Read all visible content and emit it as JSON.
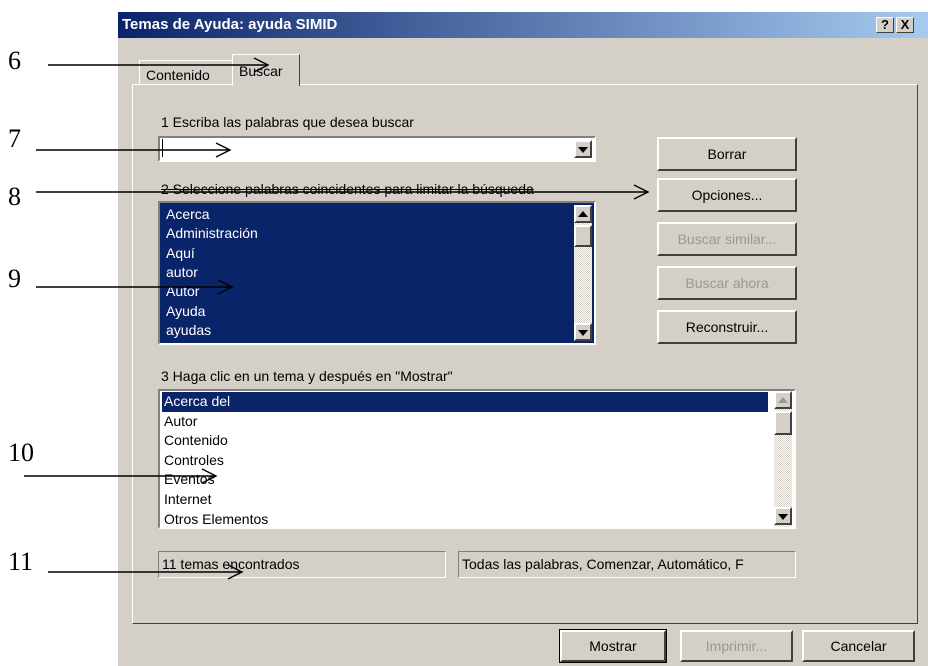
{
  "window": {
    "title": "Temas de Ayuda: ayuda SIMID",
    "help_btn": "?",
    "close_btn": "X"
  },
  "tabs": [
    {
      "label": "Contenido",
      "active": false
    },
    {
      "label": "Buscar",
      "active": true
    }
  ],
  "step1": {
    "label": "1 Escriba las palabras que desea buscar",
    "value": ""
  },
  "step2": {
    "label": "2 Seleccione palabras coincidentes para limitar la búsqueda",
    "items": [
      "Acerca",
      "Administración",
      "Aquí",
      "autor",
      "Autor",
      "Ayuda",
      "ayudas"
    ]
  },
  "step3": {
    "label": "3 Haga clic en un tema y después en \"Mostrar\"",
    "items": [
      "Acerca del",
      "Autor",
      "Contenido",
      "Controles",
      "Eventos",
      "Internet",
      "Otros Elementos"
    ]
  },
  "side_buttons": {
    "borrar": "Borrar",
    "opciones": "Opciones...",
    "buscar_similar": "Buscar similar...",
    "buscar_ahora": "Buscar ahora",
    "reconstruir": "Reconstruir..."
  },
  "status": {
    "found": "11 temas encontrados",
    "options": "Todas las palabras, Comenzar, Automático, F"
  },
  "bottom_buttons": {
    "mostrar": "Mostrar",
    "imprimir": "Imprimir...",
    "cancelar": "Cancelar"
  },
  "annotations": [
    "6",
    "7",
    "8",
    "9",
    "10",
    "11"
  ]
}
